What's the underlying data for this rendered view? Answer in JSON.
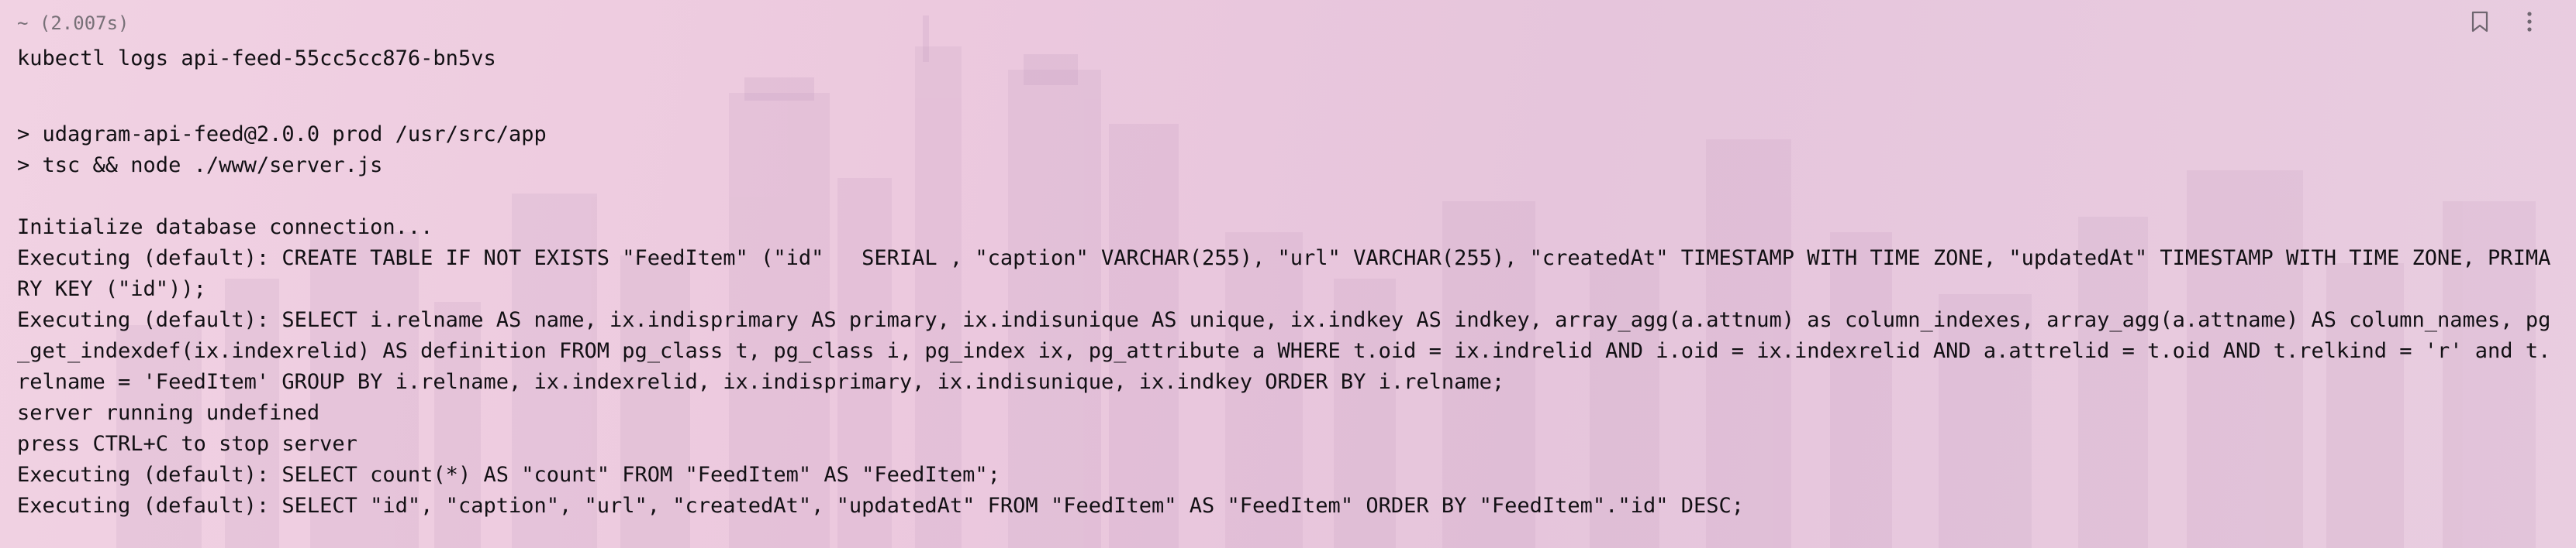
{
  "block": {
    "cwd_timing": "~ (2.007s)",
    "command": "kubectl logs api-feed-55cc5cc876-bn5vs",
    "bookmark_icon": "bookmark-icon",
    "more_icon": "more-vertical-icon"
  },
  "output": {
    "lines": [
      "> udagram-api-feed@2.0.0 prod /usr/src/app",
      "> tsc && node ./www/server.js",
      "",
      "Initialize database connection...",
      "Executing (default): CREATE TABLE IF NOT EXISTS \"FeedItem\" (\"id\"   SERIAL , \"caption\" VARCHAR(255), \"url\" VARCHAR(255), \"createdAt\" TIMESTAMP WITH TIME ZONE, \"updatedAt\" TIMESTAMP WITH TIME ZONE, PRIMARY KEY (\"id\"));",
      "Executing (default): SELECT i.relname AS name, ix.indisprimary AS primary, ix.indisunique AS unique, ix.indkey AS indkey, array_agg(a.attnum) as column_indexes, array_agg(a.attname) AS column_names, pg_get_indexdef(ix.indexrelid) AS definition FROM pg_class t, pg_class i, pg_index ix, pg_attribute a WHERE t.oid = ix.indrelid AND i.oid = ix.indexrelid AND a.attrelid = t.oid AND t.relkind = 'r' and t.relname = 'FeedItem' GROUP BY i.relname, ix.indexrelid, ix.indisprimary, ix.indisunique, ix.indkey ORDER BY i.relname;",
      "server running undefined",
      "press CTRL+C to stop server",
      "Executing (default): SELECT count(*) AS \"count\" FROM \"FeedItem\" AS \"FeedItem\";",
      "Executing (default): SELECT \"id\", \"caption\", \"url\", \"createdAt\", \"updatedAt\" FROM \"FeedItem\" AS \"FeedItem\" ORDER BY \"FeedItem\".\"id\" DESC;"
    ]
  }
}
